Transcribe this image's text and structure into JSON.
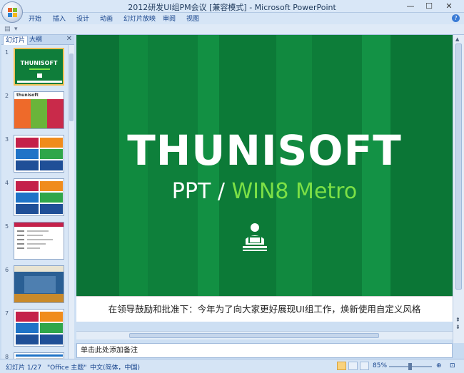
{
  "window": {
    "title": "2012研发UI组PM会议 [兼容模式] - Microsoft PowerPoint",
    "minimize": "—",
    "maximize": "☐",
    "close": "✕"
  },
  "ribbon": {
    "tabs": [
      "开始",
      "插入",
      "设计",
      "动画",
      "幻灯片放映",
      "审阅",
      "视图"
    ]
  },
  "left_panel": {
    "tab_slides": "幻灯片",
    "tab_outline": "大纲",
    "close": "✕",
    "thumbnails": [
      {
        "num": "1",
        "label": "THUNISOFT"
      },
      {
        "num": "2",
        "label": "thunisoft"
      },
      {
        "num": "3"
      },
      {
        "num": "4"
      },
      {
        "num": "5"
      },
      {
        "num": "6"
      },
      {
        "num": "7"
      },
      {
        "num": "8"
      }
    ]
  },
  "slide": {
    "title": "THUNISOFT",
    "subtitle_left": "PPT /",
    "subtitle_accent": "WIN8 Metro",
    "caption": "在领导鼓励和批准下：今年为了向大家更好展现UI组工作，焕新使用自定义风格",
    "colors": {
      "background": "#0d7f3a",
      "accent": "#7ce046"
    }
  },
  "notes": {
    "placeholder": "单击此处添加备注"
  },
  "status": {
    "slide_info": "幻灯片 1/27",
    "theme": "\"Office 主题\"",
    "language": "中文(简体，中国)",
    "zoom": "85%"
  }
}
